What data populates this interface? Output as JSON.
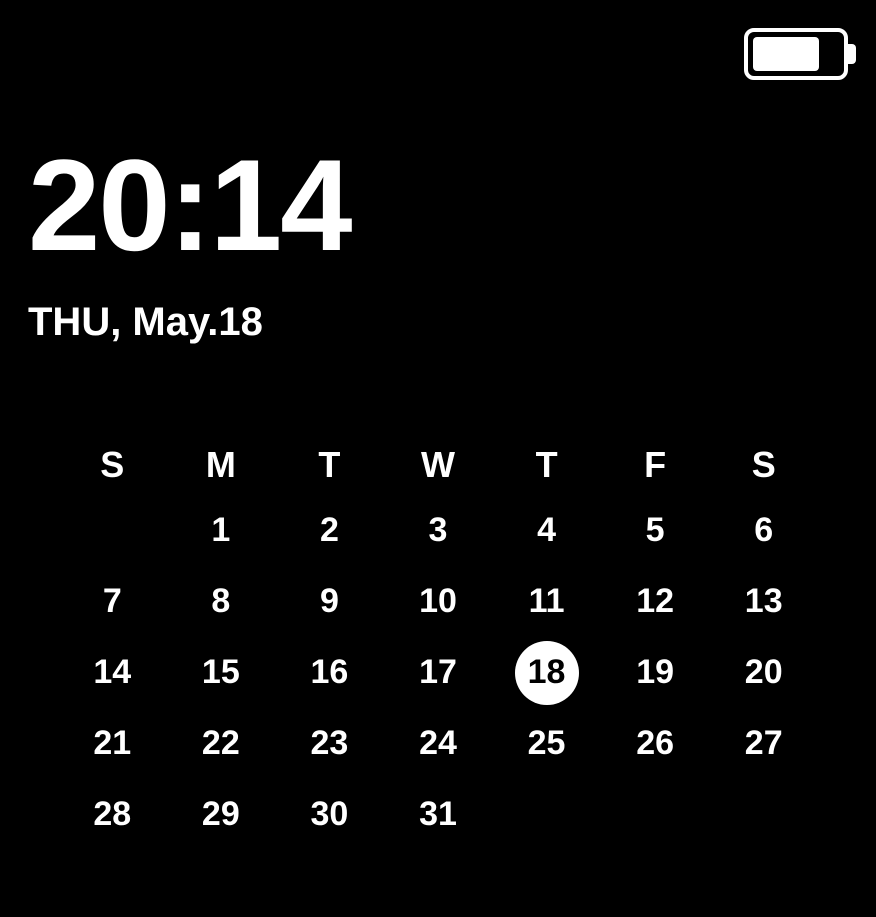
{
  "status": {
    "battery_level": 0.73
  },
  "clock": {
    "time": "20:14",
    "date": "THU, May.18"
  },
  "calendar": {
    "weekday_headers": [
      "S",
      "M",
      "T",
      "W",
      "T",
      "F",
      "S"
    ],
    "today": 18,
    "weeks": [
      [
        "",
        "1",
        "2",
        "3",
        "4",
        "5",
        "6"
      ],
      [
        "7",
        "8",
        "9",
        "10",
        "11",
        "12",
        "13"
      ],
      [
        "14",
        "15",
        "16",
        "17",
        "18",
        "19",
        "20"
      ],
      [
        "21",
        "22",
        "23",
        "24",
        "25",
        "26",
        "27"
      ],
      [
        "28",
        "29",
        "30",
        "31",
        "",
        "",
        ""
      ]
    ]
  }
}
